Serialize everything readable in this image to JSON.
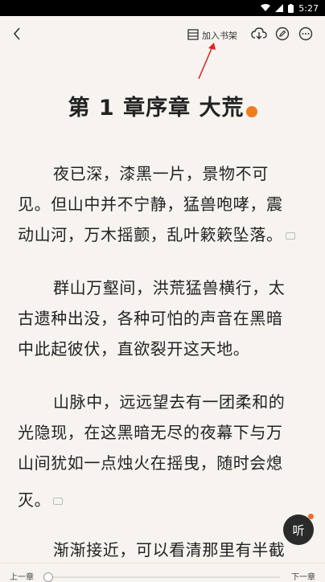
{
  "status_bar": {
    "time": "5:27"
  },
  "toolbar": {
    "add_to_shelf_label": "加入书架"
  },
  "chapter": {
    "title": "第 1 章序章 大荒",
    "paragraphs": [
      [
        "夜已深，漆黑一片，景物不可",
        "见。但山中并不宁静，猛兽咆哮，震",
        "动山河，万木摇颤，乱叶簌簌坠落。"
      ],
      [
        "群山万壑间，洪荒猛兽横行，太",
        "古遗种出没，各种可怕的声音在黑暗",
        "中此起彼伏，直欲裂开这天地。"
      ],
      [
        "山脉中，远远望去有一团柔和的",
        "光隐现，在这黑暗无尽的夜幕下与万",
        "山间犹如一点烛火在摇曳，随时会熄",
        "灭。"
      ],
      [
        "渐渐接近，可以看清那里有半截"
      ]
    ]
  },
  "listen_button": {
    "label": "听"
  },
  "bottom_bar": {
    "prev_label": "上一章",
    "next_label": "下一章"
  },
  "colors": {
    "background": "#f7f4f0",
    "accent": "#f27a1f",
    "annotation_arrow": "#e02020"
  }
}
